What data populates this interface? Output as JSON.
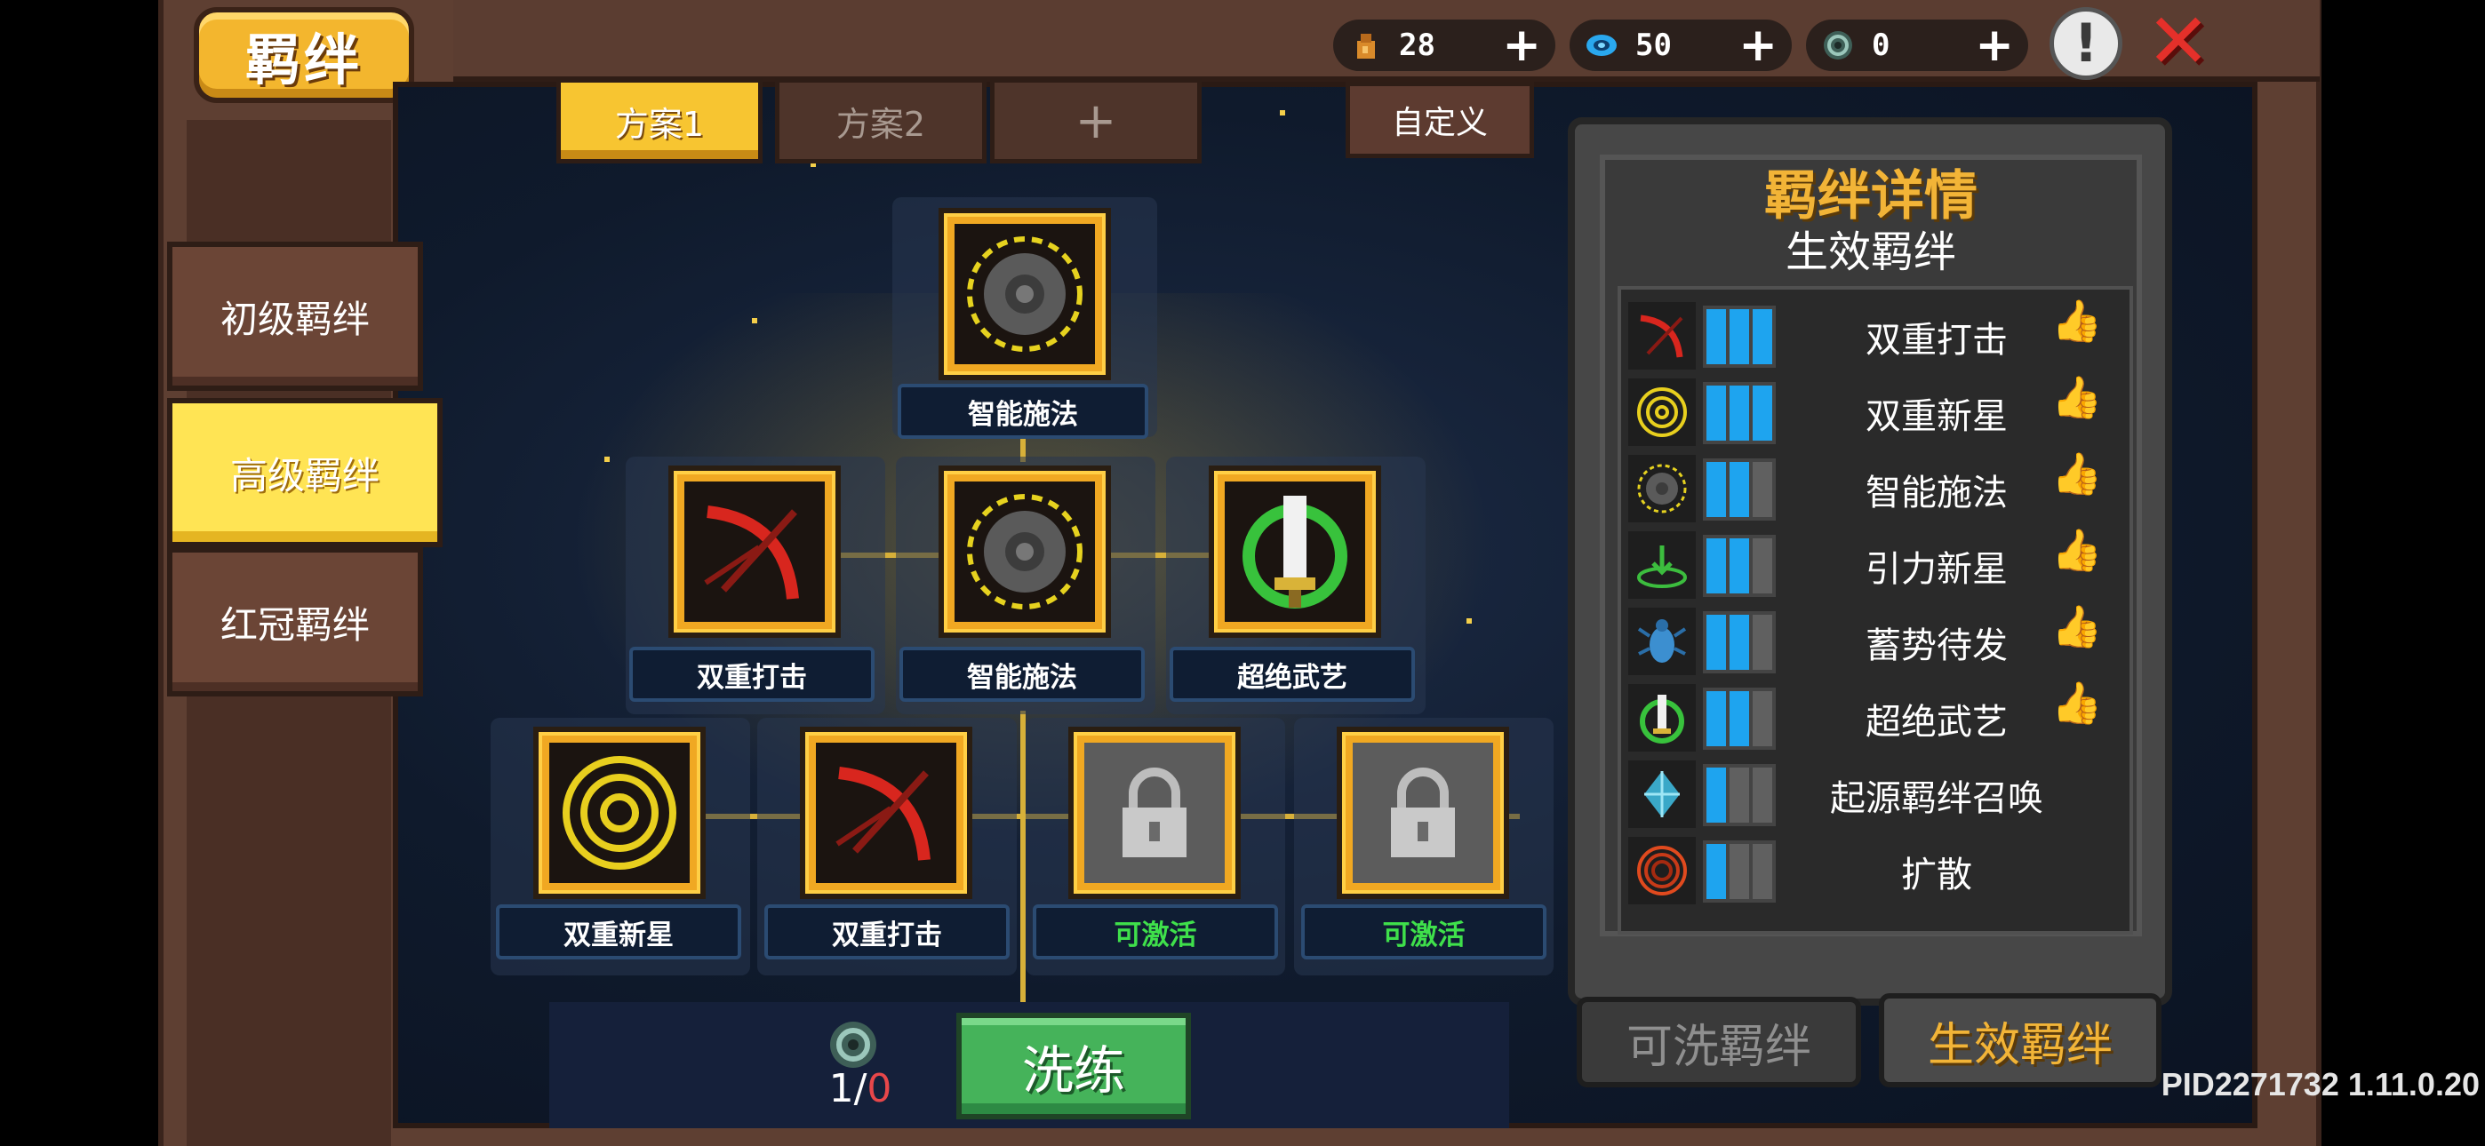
{
  "header": {
    "title": "羁绊",
    "resources": [
      {
        "icon": "gold-bag-icon",
        "value": "28"
      },
      {
        "icon": "gem-icon",
        "value": "50"
      },
      {
        "icon": "vortex-token-icon",
        "value": "0"
      }
    ],
    "plus": "+",
    "warning": "!",
    "close": "✕"
  },
  "plan_tabs": [
    "方案1",
    "方案2",
    "+"
  ],
  "custom_button": "自定义",
  "side_tabs": [
    "初级羁绊",
    "高级羁绊",
    "红冠羁绊"
  ],
  "tree_nodes": {
    "top": "智能施法",
    "mid": [
      "双重打击",
      "智能施法",
      "超绝武艺"
    ],
    "bottom": [
      "双重新星",
      "双重打击",
      "可激活",
      "可激活"
    ]
  },
  "reroll": {
    "count": "1",
    "max": "0",
    "separator": "/",
    "button": "洗练"
  },
  "detail": {
    "title": "羁绊详情",
    "subtitle": "生效羁绊",
    "items": [
      {
        "name": "双重打击",
        "icon": "crossbow-icon",
        "level": 3,
        "thumb": true
      },
      {
        "name": "双重新星",
        "icon": "nova-ring-icon",
        "level": 3,
        "thumb": true
      },
      {
        "name": "智能施法",
        "icon": "gear-icon",
        "level": 2,
        "thumb": true
      },
      {
        "name": "引力新星",
        "icon": "gravity-icon",
        "level": 2,
        "thumb": true
      },
      {
        "name": "蓄势待发",
        "icon": "beetle-icon",
        "level": 2,
        "thumb": true
      },
      {
        "name": "超绝武艺",
        "icon": "sword-icon",
        "level": 2,
        "thumb": true
      },
      {
        "name": "起源羁绊召唤",
        "icon": "crystal-icon",
        "level": 1,
        "thumb": false
      },
      {
        "name": "扩散",
        "icon": "spread-ring-icon",
        "level": 1,
        "thumb": false
      }
    ]
  },
  "bottom_tabs": [
    "可洗羁绊",
    "生效羁绊"
  ],
  "version": "PID2271732 1.11.0.20",
  "colors": {
    "accent_gold": "#f2b437",
    "bar_active": "#1ea4ef",
    "activate_green": "#3fe04b"
  }
}
